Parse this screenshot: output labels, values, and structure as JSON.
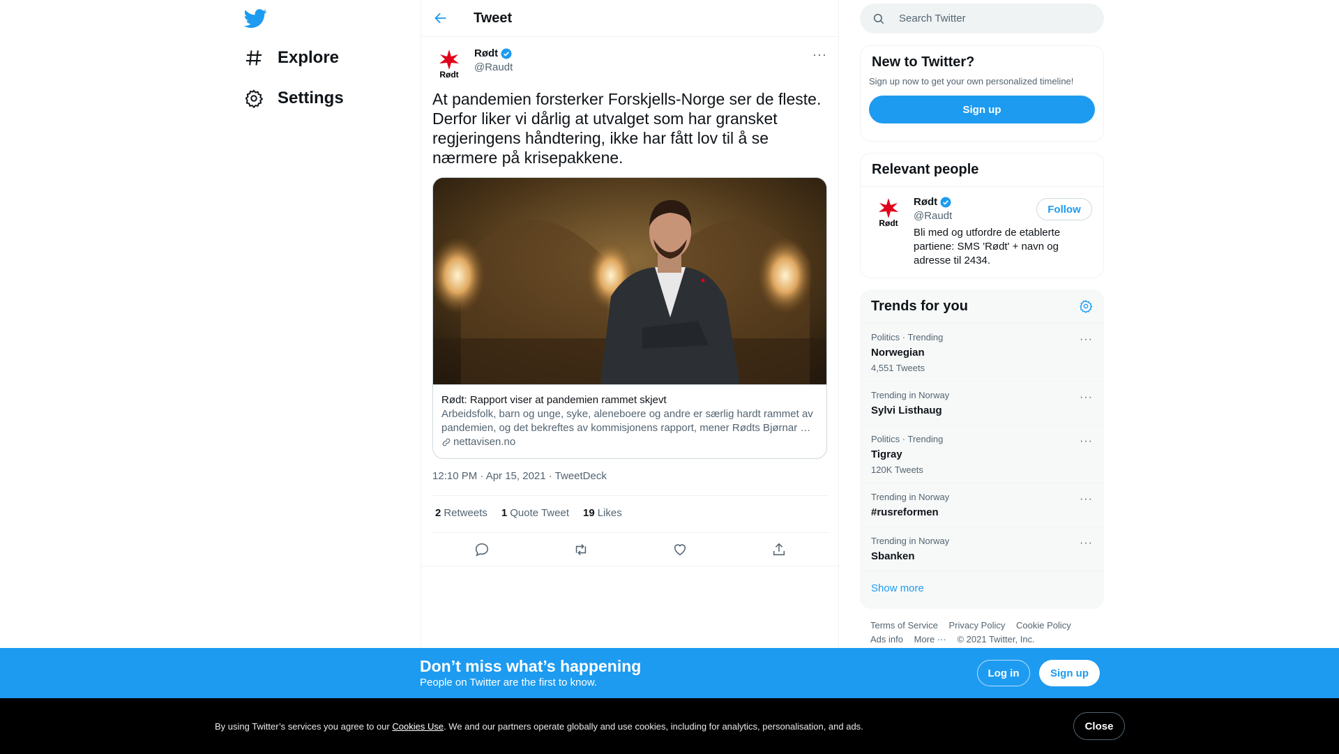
{
  "nav": {
    "explore_label": "Explore",
    "settings_label": "Settings"
  },
  "header": {
    "title": "Tweet"
  },
  "tweet": {
    "author_name": "Rødt",
    "author_handle": "@Raudt",
    "avatar_text": "Rødt",
    "text": "At pandemien forsterker Forskjells-Norge ser de fleste. Derfor liker vi dårlig at utvalget som har gransket regjeringens håndtering, ikke har fått lov til å se nærmere på krisepakkene.",
    "card": {
      "title": "Rødt: Rapport viser at pandemien rammet skjevt",
      "description": "Arbeidsfolk, barn og unge, syke, aleneboere og andre er særlig hardt rammet av pandemien, og det bekreftes av kommisjonens rapport, mener Rødts Bjørnar …",
      "domain": "nettavisen.no"
    },
    "timestamp": "12:10 PM · Apr 15, 2021 · TweetDeck",
    "stats": {
      "retweets_count": "2",
      "retweets_label": "Retweets",
      "quotes_count": "1",
      "quotes_label": "Quote Tweet",
      "likes_count": "19",
      "likes_label": "Likes"
    }
  },
  "search": {
    "placeholder": "Search Twitter"
  },
  "new_to_twitter": {
    "title": "New to Twitter?",
    "subtitle": "Sign up now to get your own personalized timeline!",
    "signup_label": "Sign up"
  },
  "relevant_people": {
    "title": "Relevant people",
    "person": {
      "name": "Rødt",
      "handle": "@Raudt",
      "bio": "Bli med og utfordre de etablerte partiene: SMS 'Rødt' + navn og adresse til 2434.",
      "follow_label": "Follow"
    }
  },
  "trends": {
    "title": "Trends for you",
    "items": [
      {
        "meta": "Politics · Trending",
        "name": "Norwegian",
        "count": "4,551 Tweets"
      },
      {
        "meta": "Trending in Norway",
        "name": "Sylvi Listhaug",
        "count": ""
      },
      {
        "meta": "Politics · Trending",
        "name": "Tigray",
        "count": "120K Tweets"
      },
      {
        "meta": "Trending in Norway",
        "name": "#rusreformen",
        "count": ""
      },
      {
        "meta": "Trending in Norway",
        "name": "Sbanken",
        "count": ""
      }
    ],
    "show_more": "Show more"
  },
  "footer": {
    "terms": "Terms of Service",
    "privacy": "Privacy Policy",
    "cookie": "Cookie Policy",
    "ads": "Ads info",
    "more": "More ···",
    "copyright": "© 2021 Twitter, Inc."
  },
  "banner": {
    "title": "Don’t miss what’s happening",
    "subtitle": "People on Twitter are the first to know.",
    "login_label": "Log in",
    "signup_label": "Sign up"
  },
  "cookie": {
    "prefix": "By using Twitter’s services you agree to our ",
    "link": "Cookies Use",
    "suffix": ". We and our partners operate globally and use cookies, including for analytics, personalisation, and ads.",
    "close_label": "Close"
  },
  "colors": {
    "accent": "#1d9bf0",
    "text": "#0f1419",
    "secondary": "#536471",
    "party_red": "#e1001a"
  }
}
